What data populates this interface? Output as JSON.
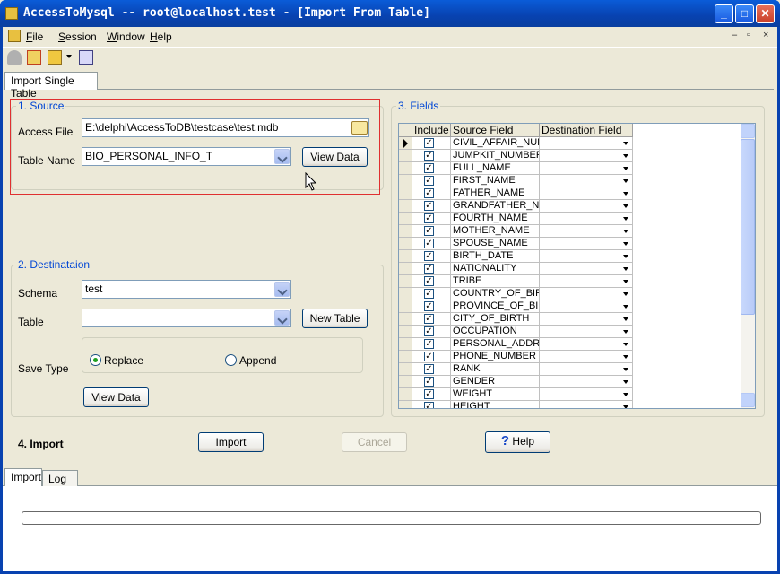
{
  "window": {
    "title": "AccessToMysql -- root@localhost.test - [Import From Table]",
    "min_label": "_",
    "max_label": "□",
    "close_label": "✕"
  },
  "menu": {
    "items": [
      "File",
      "Session",
      "Window",
      "Help"
    ],
    "mdi_min": "–",
    "mdi_restore": "▫",
    "mdi_close": "×"
  },
  "tabs": {
    "main": "Import Single Table",
    "bottom": [
      "Import",
      "Log"
    ]
  },
  "source": {
    "title": "1. Source",
    "access_file_label": "Access File",
    "access_file_value": "E:\\delphi\\AccessToDB\\testcase\\test.mdb",
    "table_name_label": "Table Name",
    "table_name_value": "BIO_PERSONAL_INFO_T",
    "view_data_label": "View Data"
  },
  "destination": {
    "title": "2. Destinataion",
    "schema_label": "Schema",
    "schema_value": "test",
    "table_label": "Table",
    "table_value": "",
    "new_table_label": "New Table",
    "save_type_label": "Save Type",
    "replace_label": "Replace",
    "append_label": "Append",
    "selected": "Replace",
    "view_data_label": "View Data"
  },
  "fields": {
    "title": "3. Fields",
    "columns": [
      "Include",
      "Source Field",
      "Destination Field"
    ],
    "rows": [
      "CIVIL_AFFAIR_NUM",
      "JUMPKIT_NUMBER",
      "FULL_NAME",
      "FIRST_NAME",
      "FATHER_NAME",
      "GRANDFATHER_N",
      "FOURTH_NAME",
      "MOTHER_NAME",
      "SPOUSE_NAME",
      "BIRTH_DATE",
      "NATIONALITY",
      "TRIBE",
      "COUNTRY_OF_BIR",
      "PROVINCE_OF_BIR",
      "CITY_OF_BIRTH",
      "OCCUPATION",
      "PERSONAL_ADDR",
      "PHONE_NUMBER",
      "RANK",
      "GENDER",
      "WEIGHT",
      "HEIGHT"
    ]
  },
  "import": {
    "title": "4. Import",
    "import_label": "Import",
    "cancel_label": "Cancel",
    "help_label": "Help"
  },
  "progress": 0
}
